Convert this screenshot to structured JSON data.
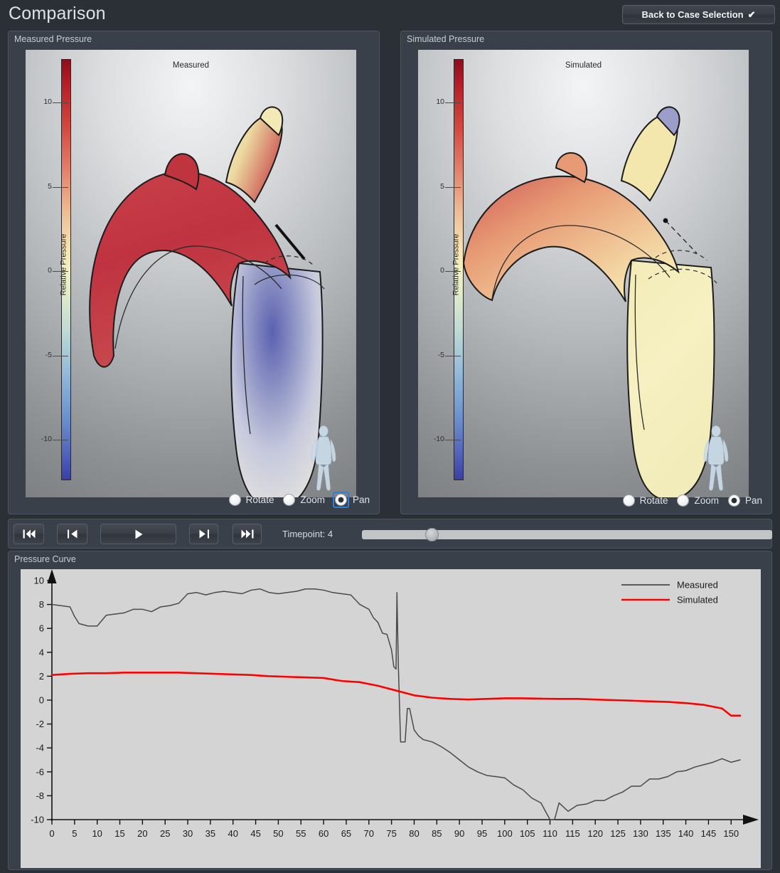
{
  "header": {
    "title": "Comparison",
    "back_button_label": "Back to Case Selection",
    "back_button_icon": "check-icon"
  },
  "viewports": [
    {
      "panel_title": "Measured Pressure",
      "scene_label": "Measured",
      "colorbar": {
        "axis_title": "Relative Pressure",
        "ticks": [
          10,
          5,
          0,
          -5,
          -10
        ],
        "min": -12.5,
        "max": 12.5,
        "colormap": "red-white-blue-diverging"
      },
      "orientation_widget": "human-figure-icon",
      "interaction_modes": [
        {
          "label": "Rotate",
          "selected": false,
          "focused": false
        },
        {
          "label": "Zoom",
          "selected": false,
          "focused": false
        },
        {
          "label": "Pan",
          "selected": true,
          "focused": true
        }
      ]
    },
    {
      "panel_title": "Simulated Pressure",
      "scene_label": "Simulated",
      "colorbar": {
        "axis_title": "Relative Pressure",
        "ticks": [
          10,
          5,
          0,
          -5,
          -10
        ],
        "min": -12.5,
        "max": 12.5,
        "colormap": "red-white-blue-diverging"
      },
      "orientation_widget": "human-figure-icon",
      "interaction_modes": [
        {
          "label": "Rotate",
          "selected": false,
          "focused": false
        },
        {
          "label": "Zoom",
          "selected": false,
          "focused": false
        },
        {
          "label": "Pan",
          "selected": true,
          "focused": false
        }
      ]
    }
  ],
  "playback": {
    "buttons": [
      {
        "name": "skip-to-start",
        "glyph": "skip-start-icon"
      },
      {
        "name": "step-backward",
        "glyph": "rewind-icon"
      },
      {
        "name": "play",
        "glyph": "play-icon"
      },
      {
        "name": "step-forward",
        "glyph": "fast-forward-icon"
      },
      {
        "name": "skip-to-end",
        "glyph": "skip-end-icon"
      }
    ],
    "timepoint_label": "Timepoint: 4",
    "timepoint_value": 4,
    "slider_percent": 17
  },
  "pressure_curve_panel": {
    "panel_title": "Pressure Curve"
  },
  "colors": {
    "measured_line": "#4a4a4a",
    "simulated_line": "#ff0000",
    "plot_background": "#d4d4d4",
    "panel_background": "#3a4049",
    "app_background": "#2b2f36",
    "accent_focus": "#2f7fd6"
  },
  "chart_data": {
    "type": "line",
    "title": "Pressure Curve",
    "xlabel": "",
    "ylabel": "",
    "xlim": [
      0,
      152
    ],
    "ylim": [
      -10,
      10
    ],
    "xticks": [
      0,
      5,
      10,
      15,
      20,
      25,
      30,
      35,
      40,
      45,
      50,
      55,
      60,
      65,
      70,
      75,
      80,
      85,
      90,
      95,
      100,
      105,
      110,
      115,
      120,
      125,
      130,
      135,
      140,
      145,
      150
    ],
    "yticks": [
      -10,
      -8,
      -6,
      -4,
      -2,
      0,
      2,
      4,
      6,
      8,
      10
    ],
    "grid": false,
    "legend_position": "top-right",
    "legend": [
      "Measured",
      "Simulated"
    ],
    "series": [
      {
        "name": "Measured",
        "color": "#4a4a4a",
        "x": [
          0,
          2,
          4,
          5,
          6,
          8,
          10,
          12,
          14,
          16,
          18,
          20,
          22,
          24,
          26,
          28,
          30,
          32,
          34,
          36,
          38,
          40,
          42,
          44,
          46,
          48,
          50,
          52,
          54,
          56,
          58,
          60,
          62,
          64,
          66,
          68,
          70,
          71,
          72,
          73,
          74,
          75,
          75.5,
          76,
          76.2,
          76.5,
          77,
          77.5,
          78,
          78.5,
          79,
          80,
          81,
          82,
          84,
          86,
          88,
          90,
          92,
          94,
          96,
          98,
          100,
          102,
          104,
          106,
          108,
          109,
          110,
          111,
          112,
          114,
          116,
          118,
          120,
          122,
          124,
          126,
          128,
          130,
          132,
          134,
          136,
          138,
          140,
          142,
          144,
          146,
          148,
          150,
          152
        ],
        "y": [
          8.0,
          7.9,
          7.8,
          7.0,
          6.4,
          6.2,
          6.2,
          7.1,
          7.2,
          7.3,
          7.6,
          7.6,
          7.4,
          7.8,
          7.9,
          8.1,
          8.9,
          9.0,
          8.8,
          9.0,
          9.1,
          9.0,
          8.9,
          9.2,
          9.3,
          9.0,
          8.9,
          9.0,
          9.1,
          9.3,
          9.3,
          9.2,
          9.0,
          8.9,
          8.8,
          8.0,
          7.6,
          6.9,
          6.5,
          5.6,
          5.5,
          4.2,
          2.8,
          2.6,
          9.0,
          3.0,
          -3.5,
          -3.5,
          -3.5,
          -0.7,
          -0.7,
          -2.5,
          -3.0,
          -3.3,
          -3.5,
          -3.9,
          -4.4,
          -5.0,
          -5.6,
          -6.0,
          -6.3,
          -6.4,
          -6.5,
          -7.1,
          -7.5,
          -8.2,
          -8.6,
          -9.3,
          -10.0,
          -10.0,
          -8.6,
          -9.3,
          -8.8,
          -8.7,
          -8.4,
          -8.4,
          -8.0,
          -7.7,
          -7.2,
          -7.2,
          -6.6,
          -6.6,
          -6.4,
          -6.0,
          -5.9,
          -5.6,
          -5.4,
          -5.2,
          -4.9,
          -5.2,
          -5.0
        ]
      },
      {
        "name": "Simulated",
        "color": "#ff0000",
        "x": [
          0,
          4,
          8,
          12,
          16,
          20,
          24,
          28,
          32,
          36,
          40,
          44,
          48,
          52,
          56,
          60,
          64,
          68,
          72,
          76,
          80,
          84,
          88,
          92,
          96,
          100,
          104,
          108,
          112,
          116,
          120,
          124,
          128,
          132,
          136,
          140,
          144,
          148,
          150,
          152
        ],
        "y": [
          2.1,
          2.2,
          2.25,
          2.25,
          2.3,
          2.3,
          2.3,
          2.3,
          2.25,
          2.2,
          2.15,
          2.1,
          2.0,
          1.95,
          1.9,
          1.85,
          1.6,
          1.5,
          1.2,
          0.8,
          0.4,
          0.2,
          0.1,
          0.05,
          0.1,
          0.15,
          0.15,
          0.12,
          0.1,
          0.1,
          0.05,
          0.0,
          -0.05,
          -0.1,
          -0.15,
          -0.25,
          -0.4,
          -0.7,
          -1.3,
          -1.3
        ]
      }
    ]
  }
}
